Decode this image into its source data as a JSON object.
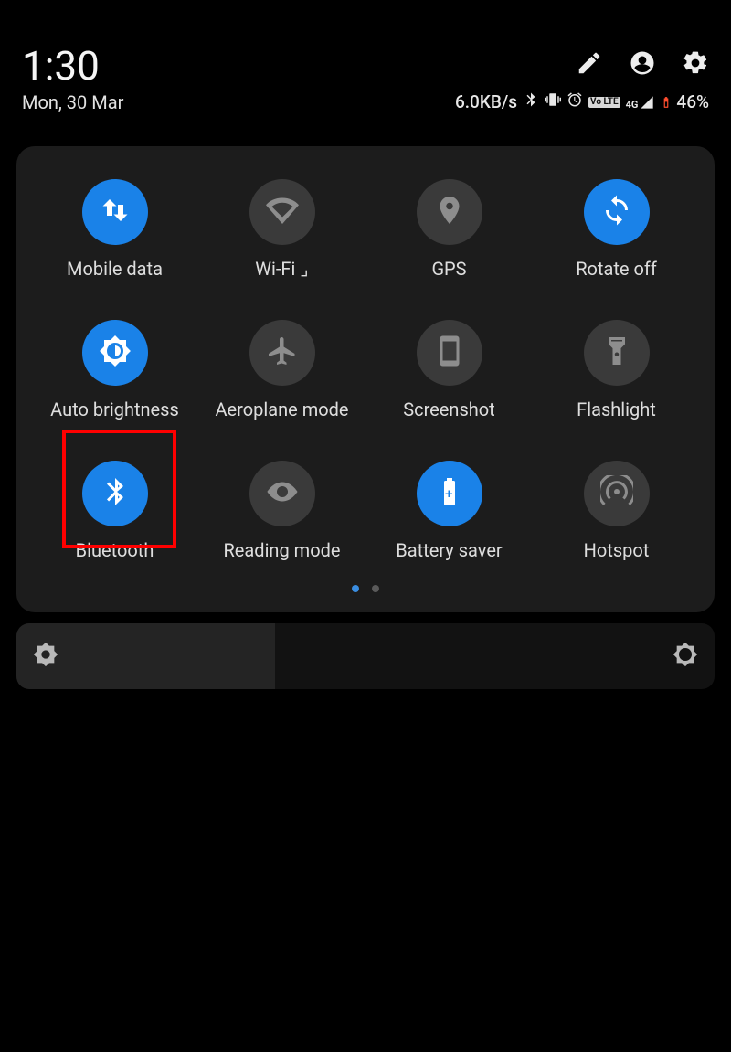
{
  "status": {
    "time": "1:30",
    "date": "Mon, 30 Mar",
    "speed": "6.0KB/s",
    "volte": "Vo LTE",
    "network": "4G",
    "battery": "46%"
  },
  "tiles": [
    {
      "label": "Mobile data",
      "on": true
    },
    {
      "label": "Wi-Fi  ⌟",
      "on": false
    },
    {
      "label": "GPS",
      "on": false
    },
    {
      "label": "Rotate off",
      "on": true
    },
    {
      "label": "Auto brightness",
      "on": true
    },
    {
      "label": "Aeroplane mode",
      "on": false
    },
    {
      "label": "Screenshot",
      "on": false
    },
    {
      "label": "Flashlight",
      "on": false
    },
    {
      "label": "Bluetooth",
      "on": true
    },
    {
      "label": "Reading mode",
      "on": false
    },
    {
      "label": "Battery saver",
      "on": true
    },
    {
      "label": "Hotspot",
      "on": false
    }
  ],
  "highlighted_tile_index": 8,
  "pager": {
    "count": 2,
    "active": 0
  }
}
